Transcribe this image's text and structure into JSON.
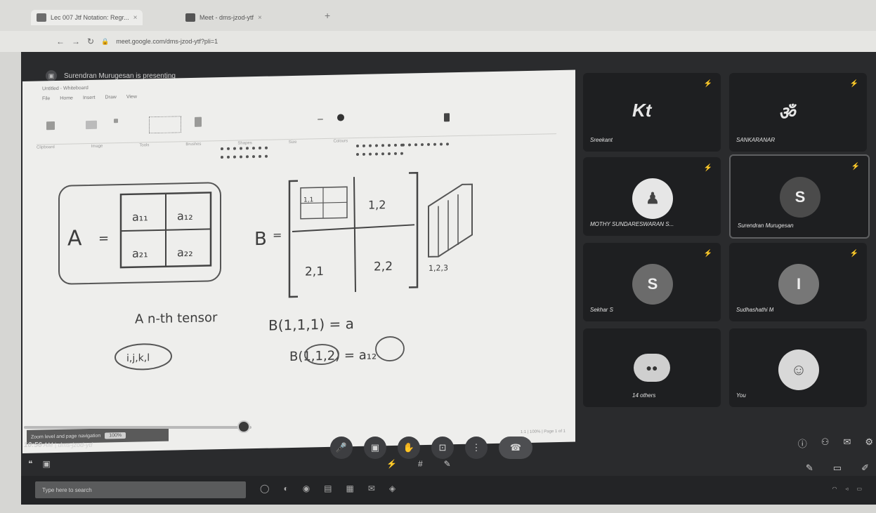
{
  "browser": {
    "tabs": [
      {
        "label": "Lec 007 Jtf Notation: Regr...",
        "close": "×"
      },
      {
        "label": "Meet - dms-jzod-ytf",
        "close": "×"
      }
    ],
    "new_tab": "+",
    "url": "meet.google.com/dms-jzod-ytf?pli=1"
  },
  "meet": {
    "presenting": "Surendran Murugesan is presenting",
    "meeting_time": "10:56",
    "meeting_code": "AM | dms-jzod-ytf"
  },
  "whiteboard": {
    "app_title": "Untitled - Whiteboard",
    "ribbon_tabs": [
      "File",
      "Home",
      "Insert",
      "Draw",
      "View"
    ],
    "ribbon_labels": [
      "Clipboard",
      "Image",
      "Tools",
      "Brushes",
      "Shapes",
      "Size",
      "Colours"
    ],
    "page_nav": "Zoom level and page navigation",
    "page_pill": "100%",
    "status": "1:1 | 100% | Page 1 of 1",
    "ink": {
      "A": "A",
      "eq": "=",
      "a11": "a₁₁",
      "a12": "a₁₂",
      "a21": "a₂₁",
      "a22": "a₂₂",
      "B": "B",
      "b11": "1,1",
      "b12": "1,2",
      "b21": "2,1",
      "b22": "2,2",
      "dims": "1,2,3",
      "tensor": "A  n-th  tensor",
      "ijkl": "i,j,k,l",
      "B1": "B(1,1,1) = a",
      "B2": "B(1,1,2) = a₁₂"
    }
  },
  "participants": [
    {
      "name": "Sreekant",
      "avatar": "Kt",
      "kind": "logo"
    },
    {
      "name": "SANKARANAR",
      "avatar": "ॐ",
      "kind": "logo"
    },
    {
      "name": "MOTHY SUNDARESWARAN S...",
      "avatar": "♟",
      "kind": "photo"
    },
    {
      "name": "Surendran Murugesan",
      "avatar": "S",
      "kind": "letter",
      "color": "#4b4b4b",
      "active": true
    },
    {
      "name": "Sekhar S",
      "avatar": "S",
      "kind": "letter",
      "color": "#6b6b6b"
    },
    {
      "name": "Sudhashathi M",
      "avatar": "I",
      "kind": "letter",
      "color": "#777777"
    },
    {
      "name": "14 others",
      "avatar": "●●",
      "kind": "group"
    },
    {
      "name": "You",
      "avatar": "☺",
      "kind": "photo"
    }
  ],
  "controls": {
    "mic": "🎤",
    "cam": "▣",
    "hand": "✋",
    "present": "⊡",
    "more": "⋮",
    "leave": "☎"
  },
  "taskbar": {
    "search_placeholder": "Type here to search"
  },
  "colors": {
    "meet_bg": "#2a2b2d",
    "tile_bg": "#1e1f21",
    "board_bg": "#eeeeec"
  }
}
